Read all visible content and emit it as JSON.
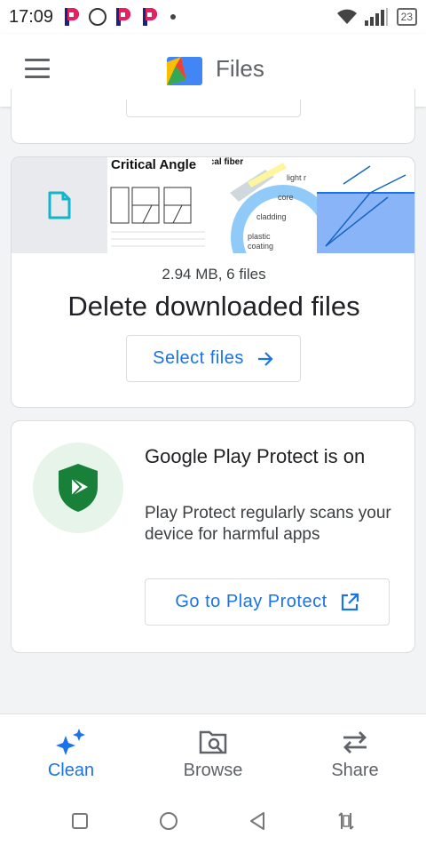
{
  "status_bar": {
    "time": "17:09",
    "battery": "23"
  },
  "app_bar": {
    "title": "Files"
  },
  "download_card": {
    "thumbnail_text": {
      "critical_angle": "Critical Angle",
      "fiber": "ical fiber",
      "core": "core",
      "cladding": "cladding",
      "plastic": "plastic",
      "coating": "coating",
      "light": "light r"
    },
    "meta": "2.94 MB, 6 files",
    "title": "Delete downloaded files",
    "button_label": "Select files"
  },
  "protect_card": {
    "title": "Google Play Protect is on",
    "description": "Play Protect regularly scans your device for harmful apps",
    "button_label": "Go to Play Protect"
  },
  "bottom_nav": [
    {
      "label": "Clean",
      "icon": "sparkle-icon",
      "active": true
    },
    {
      "label": "Browse",
      "icon": "browse-folder-icon",
      "active": false
    },
    {
      "label": "Share",
      "icon": "swap-arrows-icon",
      "active": false
    }
  ],
  "system_nav": [
    "recents-square-icon",
    "home-circle-icon",
    "back-triangle-icon",
    "rotate-icon"
  ],
  "colors": {
    "accent": "#1a73e8",
    "background": "#f1f3f4",
    "shield": "#188038",
    "shield_bg": "#e6f4ea"
  }
}
